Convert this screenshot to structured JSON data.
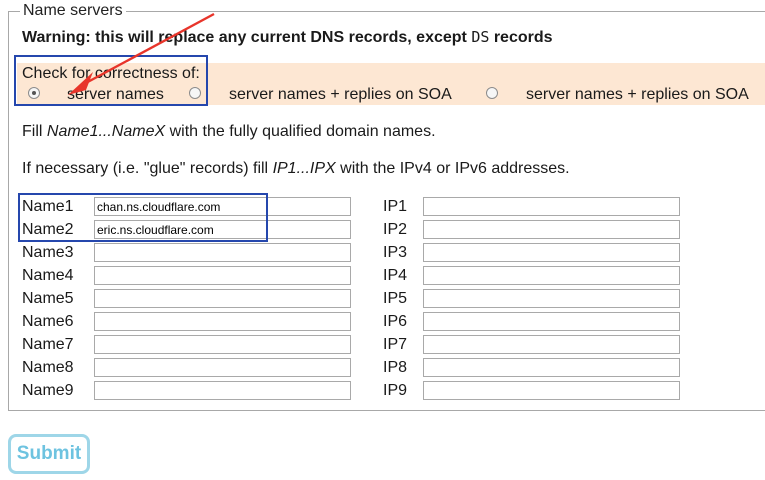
{
  "fieldset": {
    "legend": "Name servers",
    "warning_main": "Warning: this will replace any current DNS records, except ",
    "warning_code": "DS",
    "warning_tail": " records"
  },
  "check": {
    "label": "Check for correctness of:",
    "options": [
      {
        "label": "server names",
        "selected": true
      },
      {
        "label": "server names + replies on SOA",
        "selected": false
      },
      {
        "label": "server names + replies on SOA",
        "selected": false
      }
    ]
  },
  "instructions": {
    "fill_prefix": "Fill ",
    "fill_italic": "Name1...NameX",
    "fill_suffix": " with the fully qualified domain names.",
    "glue_prefix": "If necessary (i.e. \"glue\" records) fill ",
    "glue_italic": "IP1...IPX",
    "glue_suffix": " with the IPv4 or IPv6 addresses."
  },
  "rows": [
    {
      "name_label": "Name1",
      "name_value": "chan.ns.cloudflare.com",
      "ip_label": "IP1",
      "ip_value": ""
    },
    {
      "name_label": "Name2",
      "name_value": "eric.ns.cloudflare.com",
      "ip_label": "IP2",
      "ip_value": ""
    },
    {
      "name_label": "Name3",
      "name_value": "",
      "ip_label": "IP3",
      "ip_value": ""
    },
    {
      "name_label": "Name4",
      "name_value": "",
      "ip_label": "IP4",
      "ip_value": ""
    },
    {
      "name_label": "Name5",
      "name_value": "",
      "ip_label": "IP5",
      "ip_value": ""
    },
    {
      "name_label": "Name6",
      "name_value": "",
      "ip_label": "IP6",
      "ip_value": ""
    },
    {
      "name_label": "Name7",
      "name_value": "",
      "ip_label": "IP7",
      "ip_value": ""
    },
    {
      "name_label": "Name8",
      "name_value": "",
      "ip_label": "IP8",
      "ip_value": ""
    },
    {
      "name_label": "Name9",
      "name_value": "",
      "ip_label": "IP9",
      "ip_value": ""
    }
  ],
  "submit_label": "Submit",
  "colors": {
    "callout_border": "#2547ad",
    "arrow": "#e8352b",
    "check_band": "#fde7d3",
    "submit_text": "#6ec3e0",
    "submit_border": "#9ed6e8"
  }
}
